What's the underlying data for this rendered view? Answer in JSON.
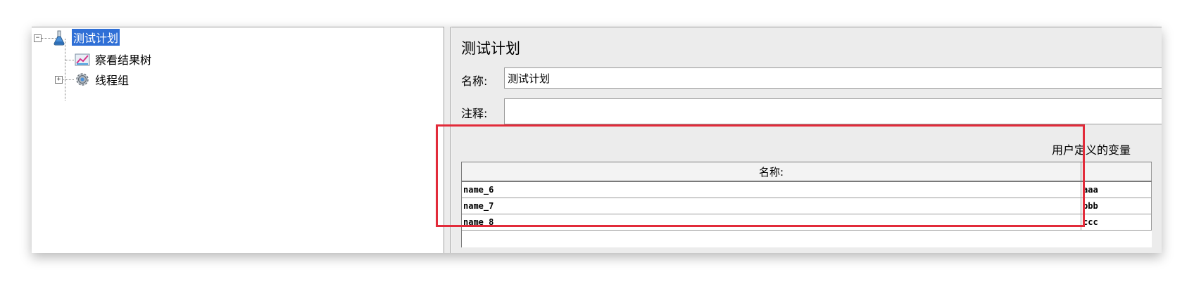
{
  "tree": {
    "root": {
      "label": "测试计划",
      "expander": "−",
      "icon": "flask-icon"
    },
    "children": [
      {
        "label": "察看结果树",
        "icon": "chart-icon"
      },
      {
        "label": "线程组",
        "icon": "gear-icon",
        "expander": "+"
      }
    ]
  },
  "panel": {
    "title": "测试计划",
    "name_label": "名称:",
    "name_value": "测试计划",
    "comment_label": "注释:",
    "comment_value": ""
  },
  "variables": {
    "section_title": "用户定义的变量",
    "columns": [
      "名称:",
      ""
    ],
    "rows": [
      [
        "name_6",
        "aaa"
      ],
      [
        "name_7",
        "bbb"
      ],
      [
        "name_8",
        "ccc"
      ]
    ]
  },
  "colors": {
    "selection": "#2f6fd6",
    "highlight_box": "#e22b3a"
  }
}
